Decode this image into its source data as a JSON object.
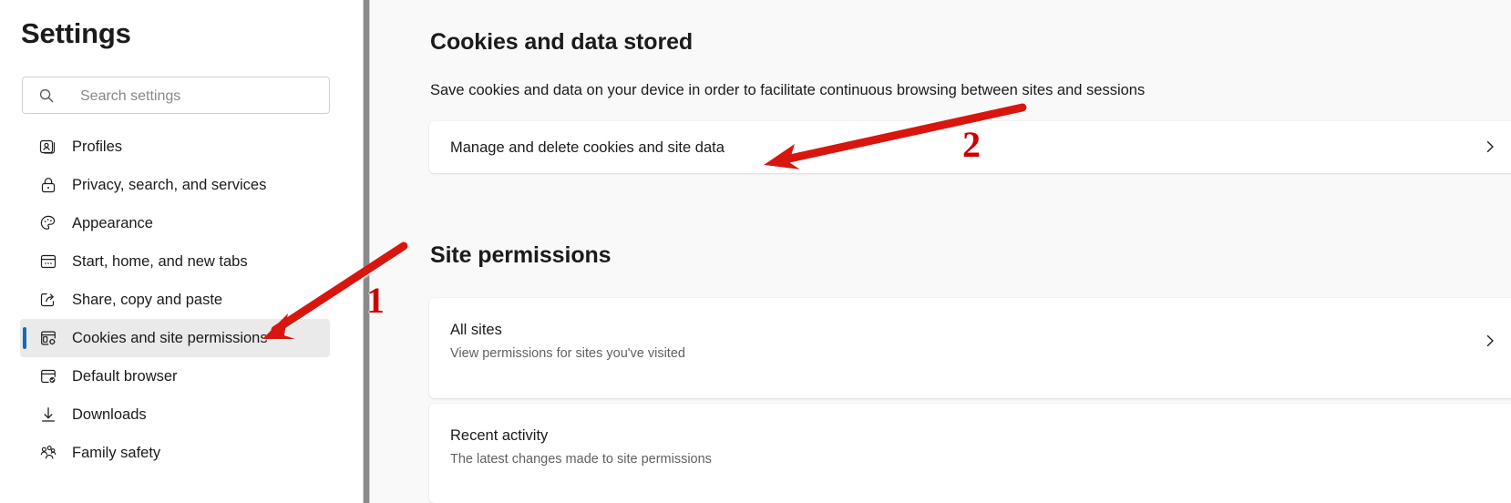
{
  "sidebar": {
    "title": "Settings",
    "search": {
      "placeholder": "Search settings",
      "value": "",
      "icon": "search-icon"
    },
    "items": [
      {
        "label": "Profiles",
        "icon": "profile-card-icon",
        "selected": false
      },
      {
        "label": "Privacy, search, and services",
        "icon": "lock-icon",
        "selected": false
      },
      {
        "label": "Appearance",
        "icon": "palette-icon",
        "selected": false
      },
      {
        "label": "Start, home, and new tabs",
        "icon": "browser-window-icon",
        "selected": false
      },
      {
        "label": "Share, copy and paste",
        "icon": "share-icon",
        "selected": false
      },
      {
        "label": "Cookies and site permissions",
        "icon": "cookies-settings-icon",
        "selected": true
      },
      {
        "label": "Default browser",
        "icon": "browser-check-icon",
        "selected": false
      },
      {
        "label": "Downloads",
        "icon": "download-icon",
        "selected": false
      },
      {
        "label": "Family safety",
        "icon": "family-icon",
        "selected": false
      }
    ]
  },
  "main": {
    "cookies_section": {
      "title": "Cookies and data stored",
      "description": "Save cookies and data on your device in order to facilitate continuous browsing between sites and sessions",
      "manage_card": {
        "title": "Manage and delete cookies and site data",
        "chevron": "chevron-right-icon"
      }
    },
    "site_permissions_section": {
      "title": "Site permissions",
      "cards": [
        {
          "title": "All sites",
          "subtitle": "View permissions for sites you've visited",
          "chevron": "chevron-right-icon"
        },
        {
          "title": "Recent activity",
          "subtitle": "The latest changes made to site permissions",
          "chevron": ""
        }
      ]
    }
  },
  "annotations": {
    "markers": [
      {
        "label": "1",
        "points_to": "Cookies and site permissions"
      },
      {
        "label": "2",
        "points_to": "Manage and delete cookies and site data"
      }
    ],
    "color": "#cc0000"
  },
  "colors": {
    "accent": "#0f6cbd",
    "selected_background": "#eaeaea",
    "main_background": "#f9f9f9",
    "card_background": "#ffffff",
    "text_primary": "#1b1b1b",
    "text_secondary": "#616161",
    "annotation_red": "#cc0000"
  }
}
